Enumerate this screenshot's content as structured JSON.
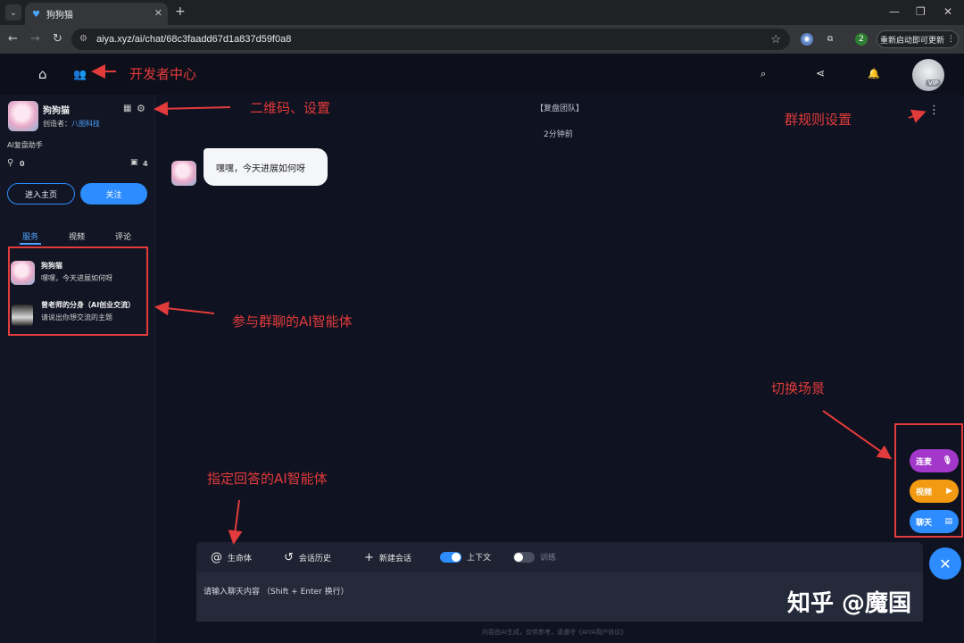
{
  "browser": {
    "tab_title": "狗狗猫",
    "url": "aiya.xyz/ai/chat/68c3faadd67d1a837d59f0a8",
    "ext_badge": "2",
    "update_button": "重新启动即可更新"
  },
  "header": {
    "vip_label": "VIP"
  },
  "profile": {
    "name": "狗狗猫",
    "creator_label": "创造者：",
    "creator_name": "八图科技",
    "description": "AI复盘助手",
    "followers": "0",
    "chats": "4",
    "enter_home": "进入主页",
    "follow": "关注"
  },
  "sidebar_tabs": [
    "服务",
    "视频",
    "评论"
  ],
  "services": [
    {
      "name": "狗狗猫",
      "desc": "嘿嘿，今天进展如何呀"
    },
    {
      "name": "曾老师的分身（AI创业交流）",
      "desc": "请说出你想交流的主题"
    }
  ],
  "chat": {
    "group_name": "【复盘团队】",
    "time": "2分钟前",
    "message": "嘿嘿，今天进展如何呀"
  },
  "composer": {
    "agent": "生命体",
    "history": "会话历史",
    "new_chat": "新建会话",
    "context": "上下文",
    "train": "训练",
    "placeholder": "请输入聊天内容 （Shift + Enter 换行）",
    "footnote": "内容由AI生成，仅供参考，请遵守《AIYA用户协议》"
  },
  "scene_buttons": [
    {
      "label": "连麦",
      "color": "#a237c9"
    },
    {
      "label": "视频",
      "color": "#f29a12"
    },
    {
      "label": "聊天",
      "color": "#2d8cff"
    }
  ],
  "annotations": {
    "dev_center": "开发者中心",
    "qr_settings": "二维码、设置",
    "group_rules": "群规则设置",
    "participants": "参与群聊的AI智能体",
    "switch_scene": "切换场景",
    "designated": "指定回答的AI智能体"
  },
  "watermark": "知乎 @魔国",
  "colors": {
    "accent": "#2d8cff",
    "annotation": "#e23b3b"
  }
}
